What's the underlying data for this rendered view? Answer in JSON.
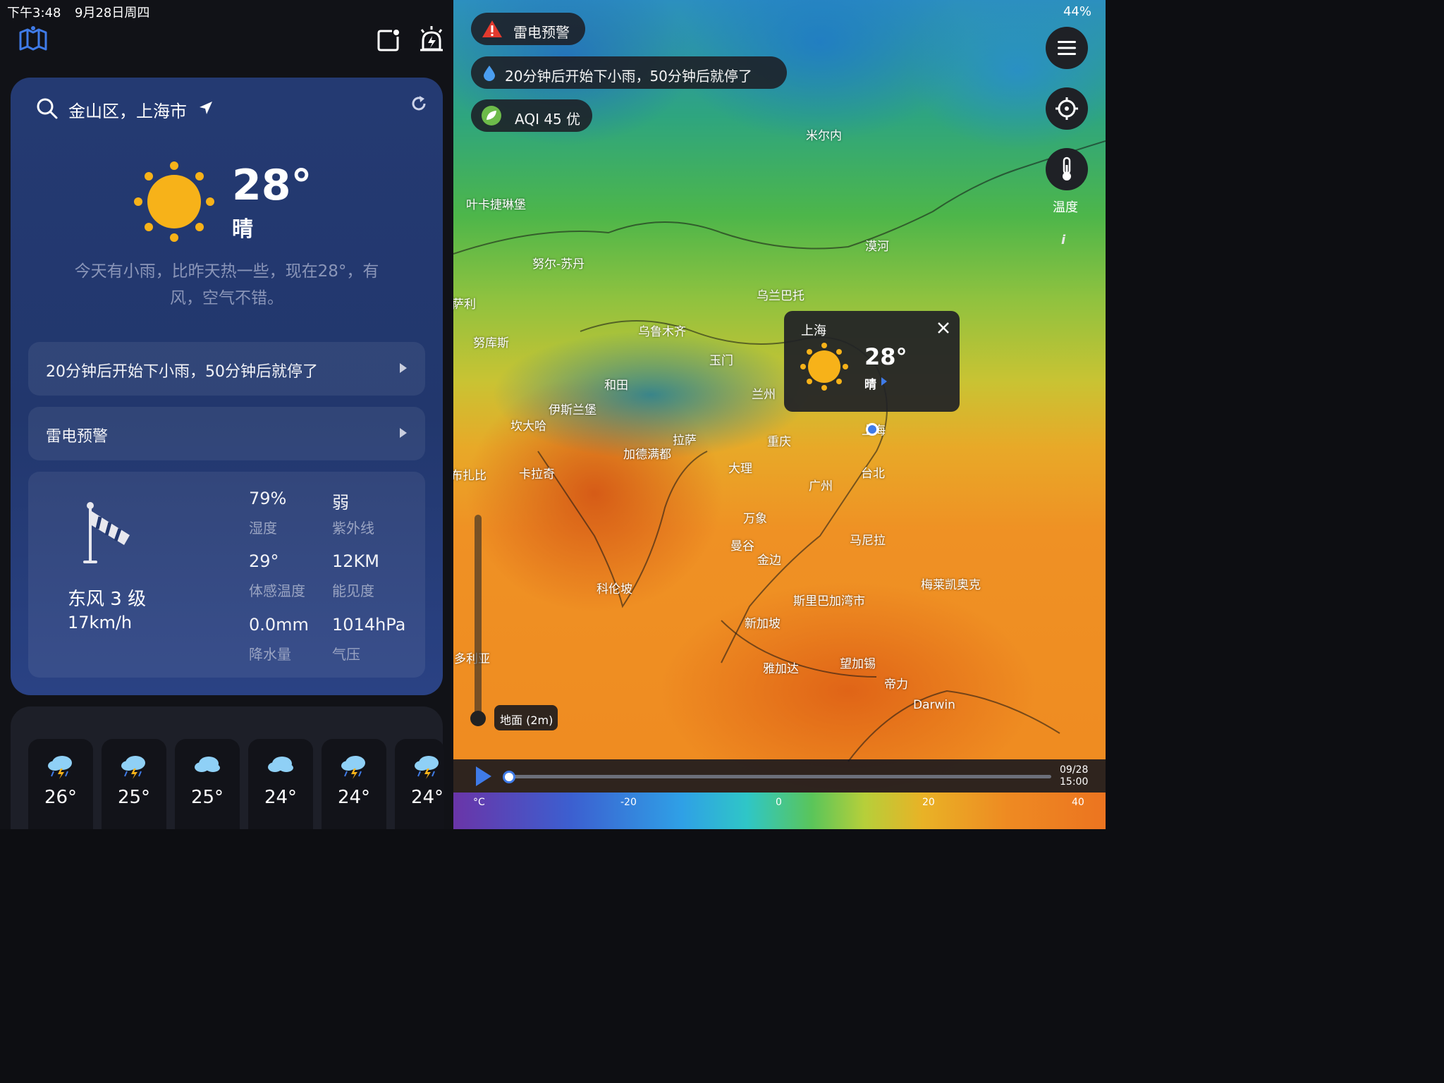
{
  "status": {
    "time": "下午3:48",
    "date": "9月28日周四",
    "battery": "44%"
  },
  "location": {
    "name": "金山区，上海市"
  },
  "current": {
    "temp": "28°",
    "condition": "晴",
    "summary_line1": "今天有小雨，比昨天热一些，现在28°，有",
    "summary_line2": "风，空气不错。"
  },
  "rain_alert": "20分钟后开始下小雨，50分钟后就停了",
  "warning": "雷电预警",
  "wind": {
    "direction": "东风 3 级",
    "speed": "17km/h"
  },
  "details": [
    {
      "value": "79%",
      "label": "湿度"
    },
    {
      "value": "弱",
      "label": "紫外线"
    },
    {
      "value": "29°",
      "label": "体感温度"
    },
    {
      "value": "12KM",
      "label": "能见度"
    },
    {
      "value": "0.0mm",
      "label": "降水量"
    },
    {
      "value": "1014hPa",
      "label": "气压"
    }
  ],
  "hourly": [
    {
      "temp": "26°",
      "icon": "thunder-rain-icon"
    },
    {
      "temp": "25°",
      "icon": "thunder-rain-icon"
    },
    {
      "temp": "25°",
      "icon": "cloud-icon"
    },
    {
      "temp": "24°",
      "icon": "cloud-icon"
    },
    {
      "temp": "24°",
      "icon": "thunder-rain-icon"
    },
    {
      "temp": "24°",
      "icon": "thunder-rain-icon"
    }
  ],
  "map": {
    "pills": {
      "warning": "雷电预警",
      "rain": "20分钟后开始下小雨，50分钟后就停了",
      "aqi": "AQI 45 优"
    },
    "layer_label": "温度",
    "info_label": "i",
    "popup": {
      "city": "上海",
      "temp": "28°",
      "condition": "晴"
    },
    "altitude": "地面 (2m)",
    "time_date": "09/28",
    "time_hour": "15:00",
    "scale": {
      "unit": "°C",
      "ticks": [
        "-20",
        "0",
        "20",
        "40"
      ]
    },
    "cities": [
      {
        "name": "米尔内"
      },
      {
        "name": "叶卡捷琳堡"
      },
      {
        "name": "漠河"
      },
      {
        "name": "努尔-苏丹"
      },
      {
        "name": "乌兰巴托"
      },
      {
        "name": "萨利"
      },
      {
        "name": "乌鲁木齐"
      },
      {
        "name": "努库斯"
      },
      {
        "name": "玉门"
      },
      {
        "name": "和田"
      },
      {
        "name": "兰州"
      },
      {
        "name": "伊斯兰堡"
      },
      {
        "name": "坎大哈"
      },
      {
        "name": "拉萨"
      },
      {
        "name": "重庆"
      },
      {
        "name": "加德满都"
      },
      {
        "name": "上海"
      },
      {
        "name": "大理"
      },
      {
        "name": "台北"
      },
      {
        "name": "布扎比"
      },
      {
        "name": "卡拉奇"
      },
      {
        "name": "广州"
      },
      {
        "name": "万象"
      },
      {
        "name": "马尼拉"
      },
      {
        "name": "曼谷"
      },
      {
        "name": "金边"
      },
      {
        "name": "科伦坡"
      },
      {
        "name": "梅莱凯奥克"
      },
      {
        "name": "斯里巴加湾市"
      },
      {
        "name": "新加坡"
      },
      {
        "name": "多利亚"
      },
      {
        "name": "雅加达"
      },
      {
        "name": "望加锡"
      },
      {
        "name": "帝力"
      },
      {
        "name": "Darwin"
      }
    ]
  }
}
